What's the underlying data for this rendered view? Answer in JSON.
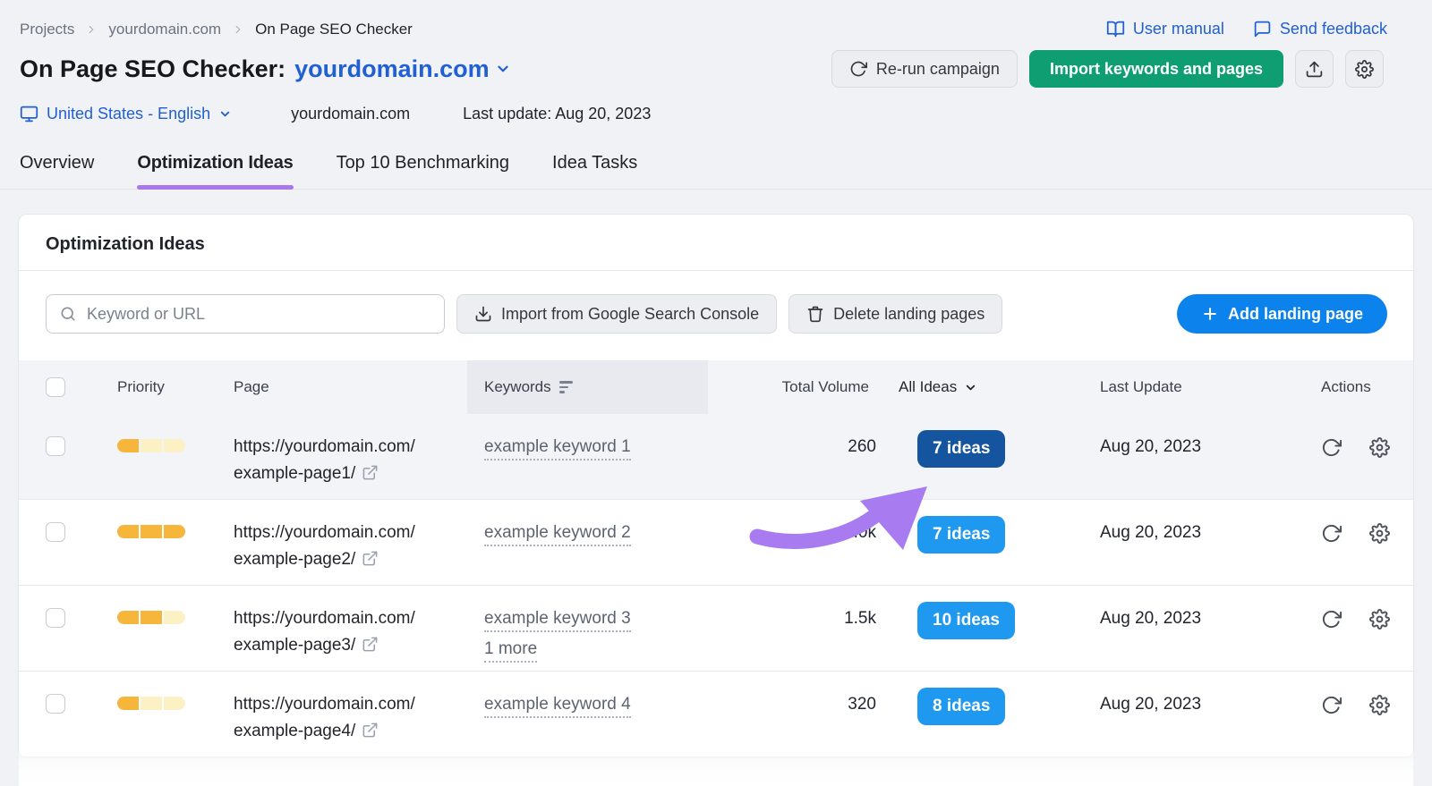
{
  "breadcrumb": {
    "items": [
      "Projects",
      "yourdomain.com",
      "On Page SEO Checker"
    ]
  },
  "top_links": {
    "user_manual": "User manual",
    "send_feedback": "Send feedback"
  },
  "title": {
    "prefix": "On Page SEO Checker:",
    "domain": "yourdomain.com"
  },
  "header_actions": {
    "rerun": "Re-run campaign",
    "import": "Import keywords and pages"
  },
  "meta": {
    "locale": "United States - English",
    "domain": "yourdomain.com",
    "last_update": "Last update: Aug 20, 2023"
  },
  "tabs": {
    "overview": "Overview",
    "optimization_ideas": "Optimization Ideas",
    "benchmarking": "Top 10 Benchmarking",
    "idea_tasks": "Idea Tasks"
  },
  "panel": {
    "title": "Optimization Ideas",
    "search_placeholder": "Keyword or URL",
    "import_gsc": "Import from Google Search Console",
    "delete_pages": "Delete landing pages",
    "add_page": "Add landing page"
  },
  "table": {
    "headers": {
      "priority": "Priority",
      "page": "Page",
      "keywords": "Keywords",
      "volume": "Total Volume",
      "ideas": "All Ideas",
      "updated": "Last Update",
      "actions": "Actions"
    },
    "rows": [
      {
        "priority": 1,
        "priority_max": 3,
        "url_line1": "https://yourdomain.com/",
        "url_line2": "example-page1/",
        "keyword": "example keyword 1",
        "volume": "260",
        "ideas": "7 ideas",
        "ideas_highlighted": true,
        "date": "Aug 20, 2023"
      },
      {
        "priority": 3,
        "priority_max": 3,
        "url_line1": "https://yourdomain.com/",
        "url_line2": "example-page2/",
        "keyword": "example keyword 2",
        "volume": "1.0k",
        "ideas": "7 ideas",
        "ideas_highlighted": false,
        "date": "Aug 20, 2023"
      },
      {
        "priority": 2,
        "priority_max": 3,
        "url_line1": "https://yourdomain.com/",
        "url_line2": "example-page3/",
        "keyword": "example keyword 3",
        "more": "1 more",
        "volume": "1.5k",
        "ideas": "10 ideas",
        "ideas_highlighted": false,
        "date": "Aug 20, 2023"
      },
      {
        "priority": 1,
        "priority_max": 3,
        "url_line1": "https://yourdomain.com/",
        "url_line2": "example-page4/",
        "keyword": "example keyword 4",
        "volume": "320",
        "ideas": "8 ideas",
        "ideas_highlighted": false,
        "date": "Aug 20, 2023"
      }
    ]
  },
  "colors": {
    "link_blue": "#2060D2",
    "add_button_blue": "#0B82EC",
    "ideas_badge_blue": "#1F98F0",
    "ideas_badge_dark_blue": "#15549F",
    "import_green": "#0E9E72",
    "tab_underline_purple": "#A878EC",
    "annotation_arrow_purple": "#A87CF0",
    "priority_fill": "#F5B63B",
    "priority_empty": "#FCF1C5"
  }
}
